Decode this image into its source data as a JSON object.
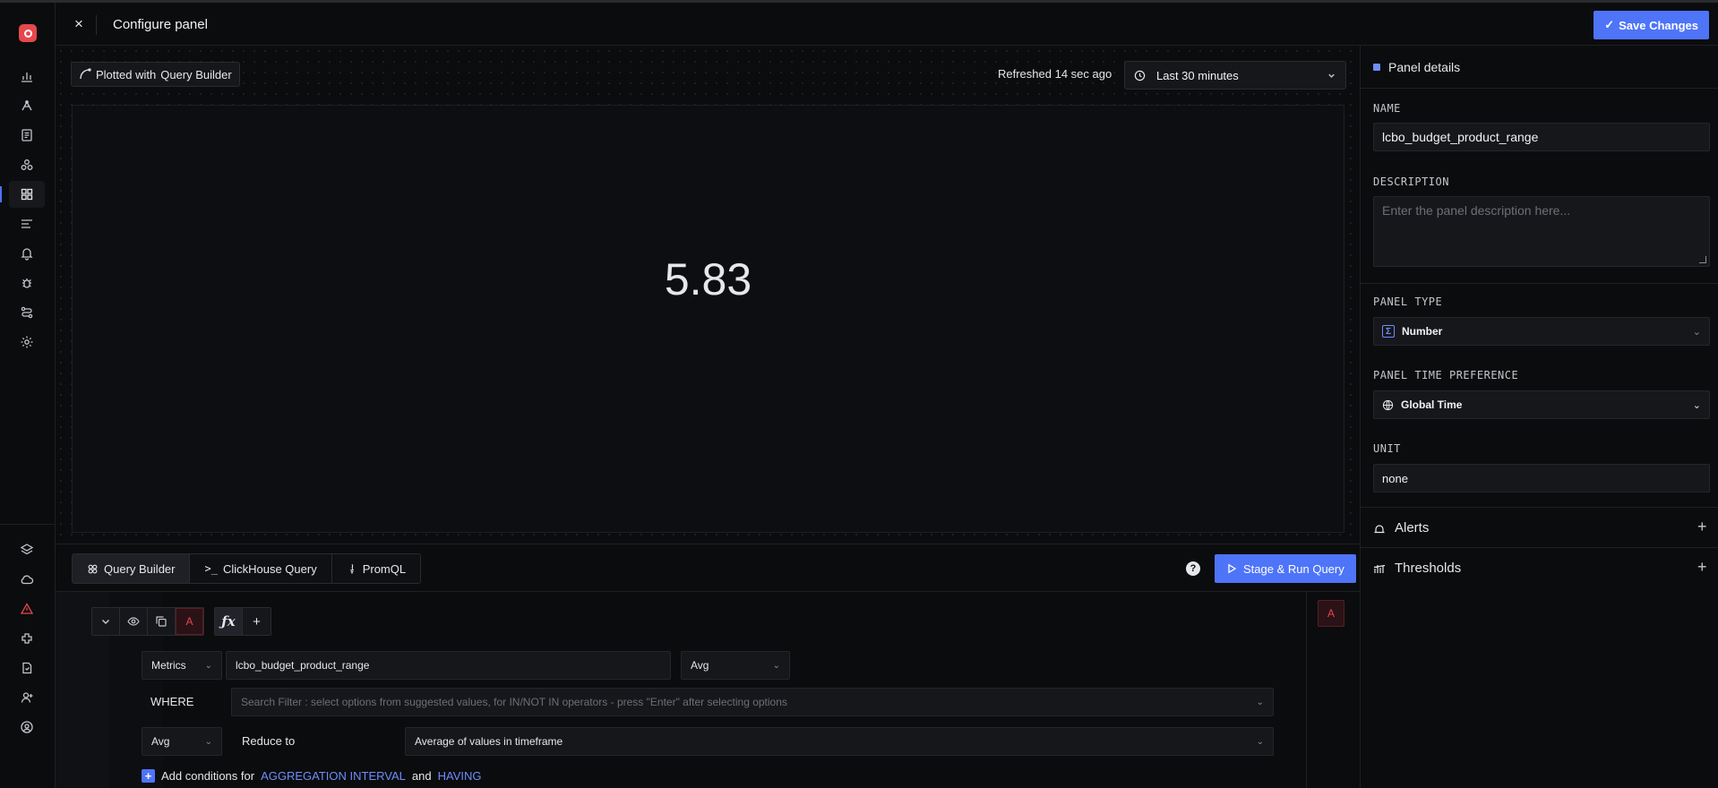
{
  "header": {
    "close_icon": "×",
    "title": "Configure panel",
    "save_label": "Save Changes"
  },
  "chart_header": {
    "plotted_prefix": "Plotted with",
    "plotted_source": "Query Builder",
    "refreshed": "Refreshed 14 sec ago",
    "time_range": "Last 30 minutes"
  },
  "panel": {
    "value": "5.83"
  },
  "query_tabs": [
    {
      "label": "Query Builder",
      "icon": "query-builder-icon"
    },
    {
      "label": "ClickHouse Query",
      "icon": "terminal-icon"
    },
    {
      "label": "PromQL",
      "icon": "promql-icon"
    }
  ],
  "stage_run_label": "Stage & Run Query",
  "help_label": "?",
  "query": {
    "letter": "A",
    "source": "Metrics",
    "metric_name": "lcbo_budget_product_range",
    "aggregate": "Avg",
    "where_label": "WHERE",
    "filter_placeholder": "Search Filter : select options from suggested values, for IN/NOT IN operators - press \"Enter\" after selecting options",
    "space_aggregate": "Avg",
    "reduce_label": "Reduce to",
    "reduce_value": "Average of values in timeframe",
    "add_cond_prefix": "Add conditions for",
    "add_cond_agg": "AGGREGATION INTERVAL",
    "add_cond_and": "and",
    "add_cond_having": "HAVING",
    "fx_label": "ƒx",
    "plus_label": "+"
  },
  "sidebar": {
    "section_title": "Panel details",
    "name_label": "NAME",
    "name_value": "lcbo_budget_product_range",
    "description_label": "DESCRIPTION",
    "description_placeholder": "Enter the panel description here...",
    "panel_type_label": "PANEL TYPE",
    "panel_type_value": "Number",
    "time_pref_label": "PANEL TIME PREFERENCE",
    "time_pref_value": "Global Time",
    "unit_label": "UNIT",
    "unit_value": "none",
    "alerts_label": "Alerts",
    "thresholds_label": "Thresholds"
  },
  "colors": {
    "accent": "#4e74f8",
    "danger": "#e5484d",
    "background": "#0b0c0e"
  }
}
